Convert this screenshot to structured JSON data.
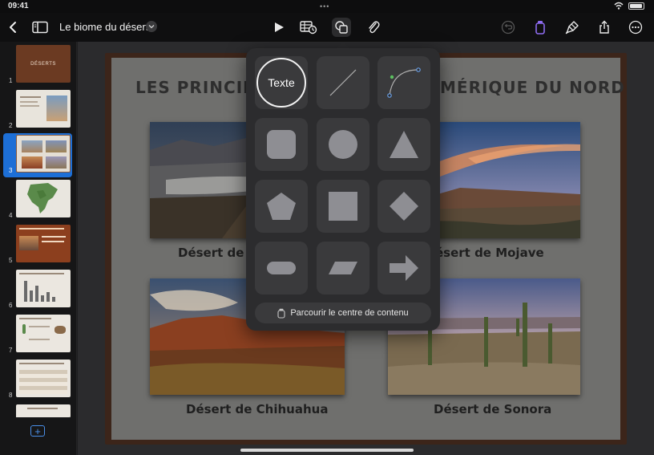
{
  "status": {
    "time": "09:41",
    "dots": "•••"
  },
  "toolbar": {
    "document_title": "Le biome du désert",
    "icons": [
      "sidebar-icon",
      "play-icon",
      "table-chart-icon",
      "shapes-icon",
      "paperclip-icon",
      "undo-icon",
      "format-brush-icon",
      "paintbrush-icon",
      "share-icon",
      "more-icon"
    ]
  },
  "sidebar": {
    "slides": [
      {
        "number": "1",
        "thumb_title": "DÉSERTS"
      },
      {
        "number": "2"
      },
      {
        "number": "3"
      },
      {
        "number": "4"
      },
      {
        "number": "5"
      },
      {
        "number": "6"
      },
      {
        "number": "7"
      },
      {
        "number": "8"
      }
    ],
    "selected_slide": "3",
    "add_label": "+"
  },
  "slide": {
    "title_left": "LES PRINCIPAU",
    "title_right": "MÉRIQUE DU NORD",
    "captions": {
      "top_left": "Désert de G",
      "top_right": "ésert de Mojave",
      "bottom_left": "Désert de Chihuahua",
      "bottom_right": "Désert de Sonora"
    }
  },
  "shapes_popover": {
    "text_shape_label": "Texte",
    "shapes": [
      "text",
      "line",
      "curve",
      "rounded-square",
      "circle",
      "triangle",
      "pentagon",
      "square",
      "diamond",
      "pill",
      "parallelogram",
      "arrow"
    ],
    "browse_label": "Parcourir le centre de contenu"
  },
  "colors": {
    "accent": "#1d6fd6",
    "purple": "#8e6cf0",
    "slide_frame": "#3c251a"
  }
}
